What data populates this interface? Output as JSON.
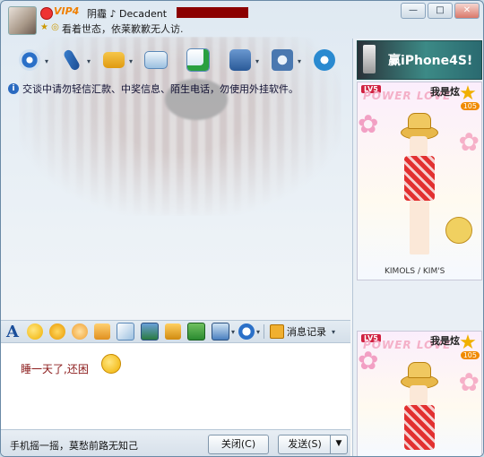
{
  "header": {
    "vip_badge": "VIP4",
    "nickname": "阴霾 ♪ Decadent",
    "signature": "看着世态，依莱歉歉无人访.",
    "window_buttons": [
      "—",
      "□",
      "✕"
    ]
  },
  "toolbar": {
    "tools": [
      {
        "icon": "webcam-icon",
        "has_dropdown": true
      },
      {
        "icon": "microphone-icon",
        "has_dropdown": true
      },
      {
        "icon": "folder-icon",
        "has_dropdown": true
      },
      {
        "icon": "mail-icon",
        "has_dropdown": false
      },
      {
        "icon": "add-app-icon",
        "has_dropdown": false
      },
      {
        "icon": "remote-assist-icon",
        "has_dropdown": true
      },
      {
        "icon": "settings-icon",
        "has_dropdown": true
      },
      {
        "icon": "refresh-app-icon",
        "has_dropdown": false
      }
    ]
  },
  "notice": {
    "text": "交谈中请勿轻信汇款、中奖信息、陌生电话，勿使用外挂软件。"
  },
  "format_bar": {
    "font_glyph": "A",
    "icons": [
      "smiley-icon",
      "magic-face-icon",
      "wink-face-icon",
      "shake-icon",
      "scribble-icon",
      "image-icon",
      "music-icon",
      "gift-icon",
      "screenshot-icon",
      "currency-icon"
    ],
    "message_record_label": "消息记录"
  },
  "input": {
    "text": "睡一天了,还困"
  },
  "bottom": {
    "hint": "手机摇一摇，莫愁前路无知己",
    "close_label": "关闭(C)",
    "send_label": "发送(S)",
    "send_arrow": "▼"
  },
  "right_panel": {
    "ad_text": "赢iPhone4S!",
    "show1": {
      "level": "LV5",
      "banner": "POWER LOVE",
      "title": "我是炫",
      "star_count": "105",
      "footer": "KIMOLS / KIM'S"
    },
    "show2": {
      "level": "LV5",
      "banner": "POWER LOVE",
      "title": "我是炫",
      "star_count": "105"
    }
  },
  "colors": {
    "accent": "#1a4e9a",
    "input_text": "#8b1a1a",
    "vip": "#f08000",
    "redaction": "#8b0000"
  }
}
